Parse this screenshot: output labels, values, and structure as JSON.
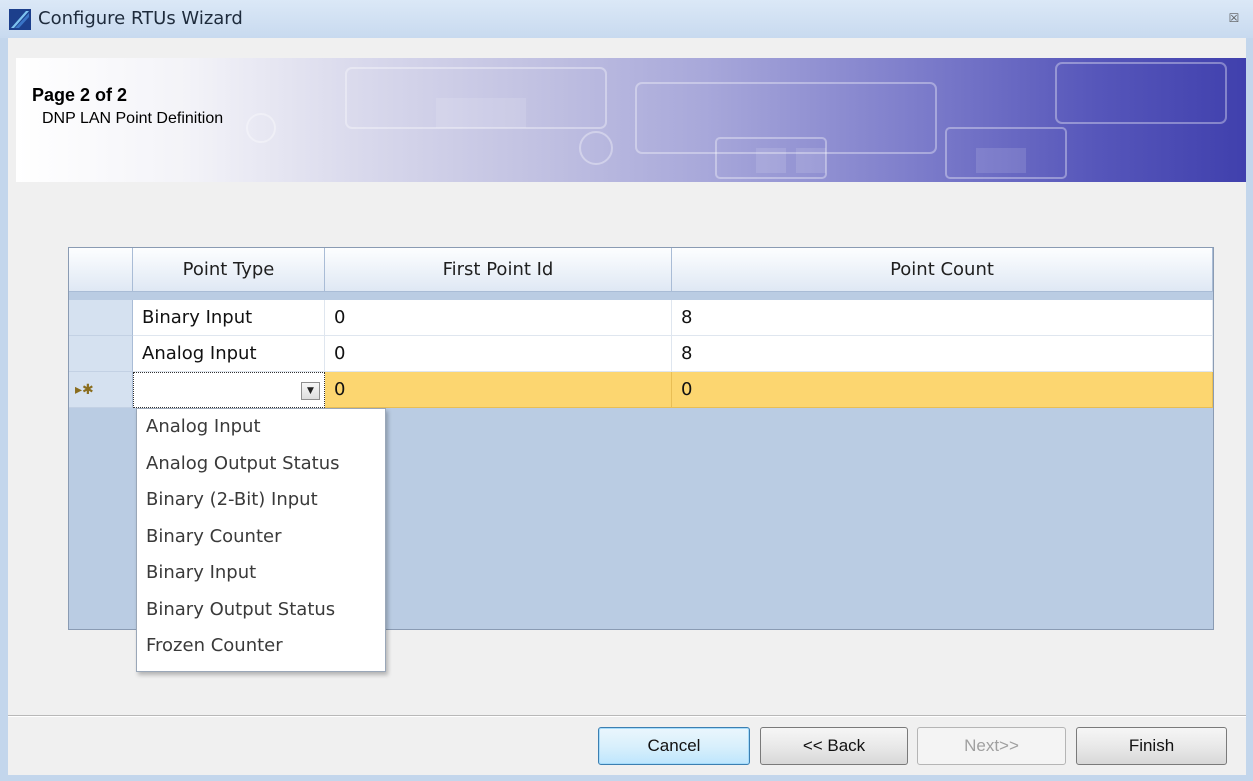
{
  "window": {
    "title": "Configure RTUs Wizard",
    "close_glyph": "☒"
  },
  "header": {
    "page_number": "Page 2 of 2",
    "page_title": "DNP LAN Point Definition"
  },
  "grid": {
    "columns": [
      "Point Type",
      "First Point Id",
      "Point Count"
    ],
    "rows": [
      {
        "point_type": "Binary Input",
        "first_point_id": "0",
        "point_count": "8"
      },
      {
        "point_type": "Analog Input",
        "first_point_id": "0",
        "point_count": "8"
      }
    ],
    "new_row": {
      "marker": "▸✱",
      "point_type": "",
      "first_point_id": "0",
      "point_count": "0"
    }
  },
  "dropdown": {
    "options": [
      "Analog Input",
      "Analog Output Status",
      "Binary (2-Bit) Input",
      "Binary Counter",
      "Binary Input",
      "Binary Output Status",
      "Frozen Counter"
    ]
  },
  "buttons": {
    "cancel": "Cancel",
    "back": "<< Back",
    "next": "Next>>",
    "finish": "Finish"
  },
  "colors": {
    "selected_row": "#fcd670",
    "grid_background": "#bacce3",
    "banner_accent": "#4040ad"
  }
}
